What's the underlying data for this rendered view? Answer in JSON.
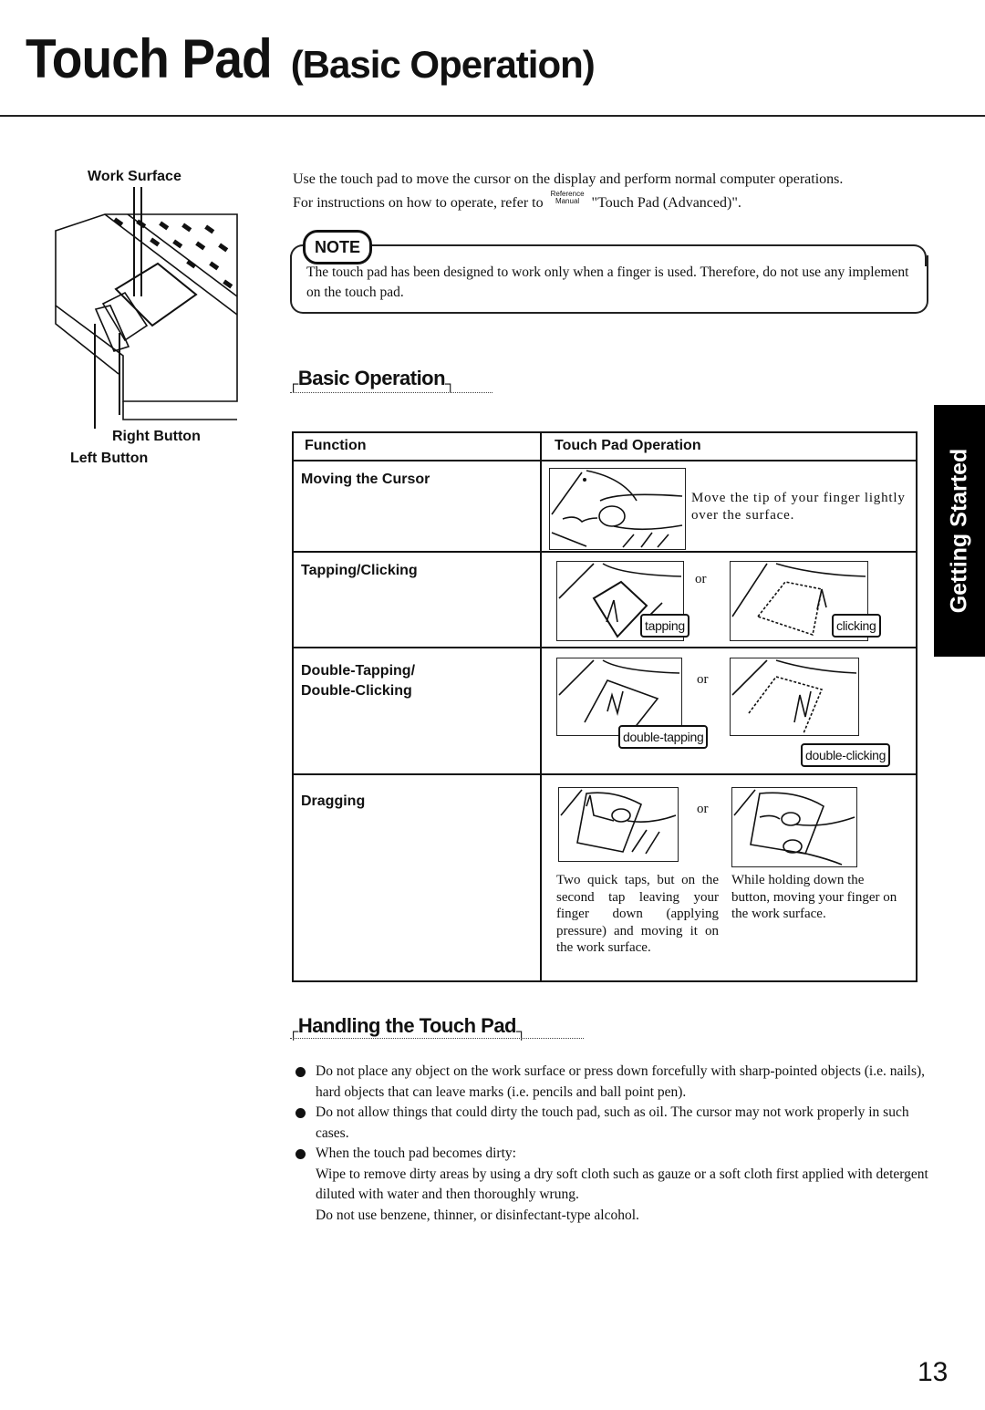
{
  "header": {
    "title_main": "Touch Pad",
    "title_sub": "(Basic Operation)"
  },
  "diagram": {
    "work_surface_label": "Work Surface",
    "right_button_label": "Right Button",
    "left_button_label": "Left Button"
  },
  "intro": {
    "line1": "Use the touch pad to move the cursor on the display and perform normal computer operations.",
    "line2_prefix": "For instructions on how to operate, refer to",
    "ref_badge_top": "Reference",
    "ref_badge_bottom": "Manual",
    "line2_suffix": "\"Touch Pad (Advanced)\"."
  },
  "note": {
    "badge": "NOTE",
    "text": "The touch pad has been designed to work only when a finger is used.  Therefore, do not use any implement on the touch pad."
  },
  "basic_operation": {
    "heading": "Basic Operation",
    "table": {
      "headers": [
        "Function",
        "Touch Pad Operation"
      ],
      "rows": [
        {
          "function": "Moving the Cursor",
          "description": "Move the tip of your finger lightly over the surface."
        },
        {
          "function": "Tapping/Clicking",
          "tags": [
            "tapping",
            "clicking"
          ],
          "or": "or"
        },
        {
          "function_line1": "Double-Tapping/",
          "function_line2": "Double-Clicking",
          "tags": [
            "double-tapping",
            "double-clicking"
          ],
          "or": "or"
        },
        {
          "function": "Dragging",
          "or": "or",
          "desc_left": "Two quick taps, but on the second tap leaving your finger down (applying pressure) and moving it on the work surface.",
          "desc_right": "While holding down the button, moving your finger on the work surface."
        }
      ]
    }
  },
  "handling": {
    "heading": "Handling the Touch Pad",
    "bullets": [
      "Do not place any object on the work surface or press down forcefully with sharp-pointed objects (i.e. nails), hard objects that can leave marks (i.e. pencils and ball point pen).",
      "Do not allow things that could dirty the touch pad, such as oil.  The cursor may not work properly in such cases.",
      "When the touch pad becomes dirty:"
    ],
    "followup": [
      "Wipe to remove dirty areas by using a dry soft cloth such as gauze or a soft cloth first applied with detergent diluted with water and then thoroughly wrung.",
      "Do not use benzene, thinner, or disinfectant-type alcohol."
    ]
  },
  "side_tab": {
    "label": "Getting Started"
  },
  "footer": {
    "page_number": "13"
  }
}
